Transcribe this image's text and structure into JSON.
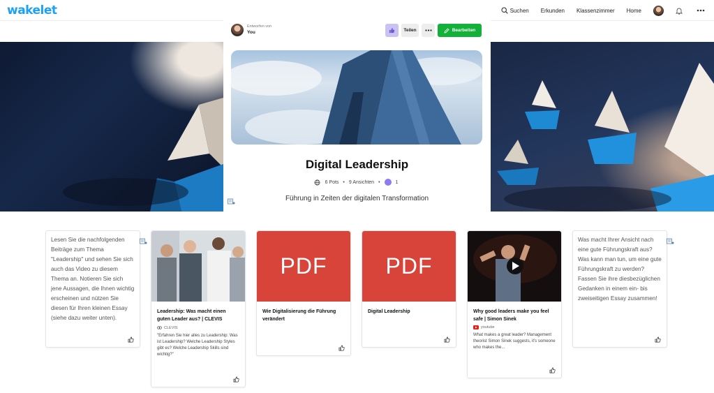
{
  "app": {
    "logo": "wakelet"
  },
  "nav": {
    "search": "Suchen",
    "explore": "Erkunden",
    "classroom": "Klassenzimmer",
    "home": "Home"
  },
  "collection": {
    "creator_label": "Entworfen von",
    "creator_name": "You",
    "share_label": "Teilen",
    "edit_label": "Bearbeiten",
    "title": "Digital Leadership",
    "posts": "6 Pots",
    "separator": "•",
    "views": "9 Ansichten",
    "likes": "1",
    "description": "Führung in Zeiten der digitalen Transformation"
  },
  "cards": {
    "intro_text": "Lesen Sie die nachfolgenden Beiträge zum Thema \"Leadership\" und sehen Sie sich auch das Video zu diesem Thema an. Notieren Sie sich jene Aussagen, die Ihnen wichtig erscheinen und nützen Sie diesen für Ihren kleinen Essay (siehe dazu weiter unten).",
    "clevis": {
      "title": "Leadership: Was macht einen guten Leader aus? | CLEVIS",
      "source": "CLEVIS",
      "excerpt": "\"Erfahren Sie hier alles zu Leadership: Was ist Leadership? Welche Leadership Styles gibt es? Welche Leadership Skills sind wichtig?\""
    },
    "pdf1": {
      "thumb_label": "PDF",
      "title": "Wie Digitalisierung die Führung verändert"
    },
    "pdf2": {
      "thumb_label": "PDF",
      "title": "Digital Leadership"
    },
    "video": {
      "title": "Why good leaders make you feel safe | Simon Sinek",
      "source": "youtube",
      "excerpt": "What makes a great leader? Management theorist Simon Sinek suggests, it's someone who makes the..."
    },
    "essay_text": "Was macht Ihrer Ansicht nach eine gute Führungskraft aus? Was kann man tun, um eine gute Führungskraft zu werden? Fassen Sie ihre diesbezüglichen Gedanken in einem ein- bis zweiseitigen Essay zusammen!"
  },
  "colors": {
    "brand": "#1da1f2",
    "edit_green": "#13b13a",
    "pdf_red": "#d9443a",
    "like_purple": "#8b7cf0"
  }
}
